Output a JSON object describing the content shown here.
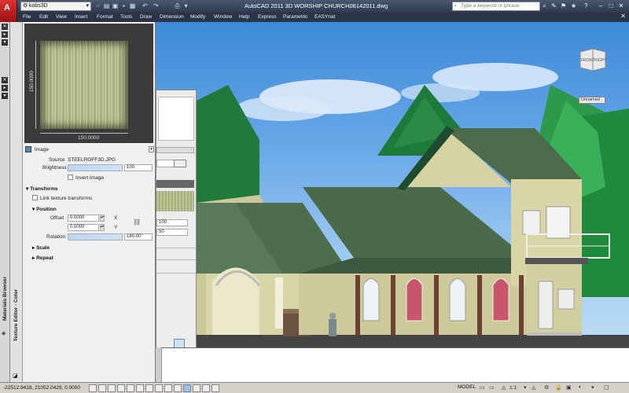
{
  "app": {
    "logo": "A",
    "workspace": "kobs3D",
    "title": "AutoCAD 2011    3D WORSHIP CHURCH06142011.dwg",
    "search_placeholder": "Type a keyword or phrase"
  },
  "menu": [
    "File",
    "Edit",
    "View",
    "Insert",
    "Format",
    "Tools",
    "Draw",
    "Dimension",
    "Modify",
    "Window",
    "Help",
    "Express",
    "Parametric",
    "EASYnat"
  ],
  "palette": {
    "vertical_label_1": "Materials Browser",
    "vertical_label_2": "Texture Editor - Color",
    "preview": {
      "dim_v": "150.0000",
      "dim_h": "150.0000"
    },
    "image_section": "Image",
    "source_label": "Source",
    "source_value": "STEELROFF3D.JPG",
    "brightness_label": "Brightness",
    "brightness_value": "100",
    "invert_label": "Invert Image",
    "transforms_section": "Transforms",
    "link_label": "Link texture transforms",
    "position_section": "Position",
    "offset_label": "Offset",
    "offset_x": "0.0000",
    "offset_y": "0.0000",
    "axis_x": "X",
    "axis_y": "Y",
    "rotation_label": "Rotation",
    "rotation_value": "180.00°",
    "scale_section": "Scale",
    "repeat_section": "Repeat"
  },
  "mat_panel": {
    "value_1": "100",
    "value_2": "50"
  },
  "viewport": {
    "navcube_front": "FRONT",
    "navcube_right": "RIGHT",
    "view_label": "Unnamed"
  },
  "status": {
    "coords": "-22512.9418, 21052.0429, 0.0000",
    "model": "MODEL",
    "scale": "1:1"
  }
}
